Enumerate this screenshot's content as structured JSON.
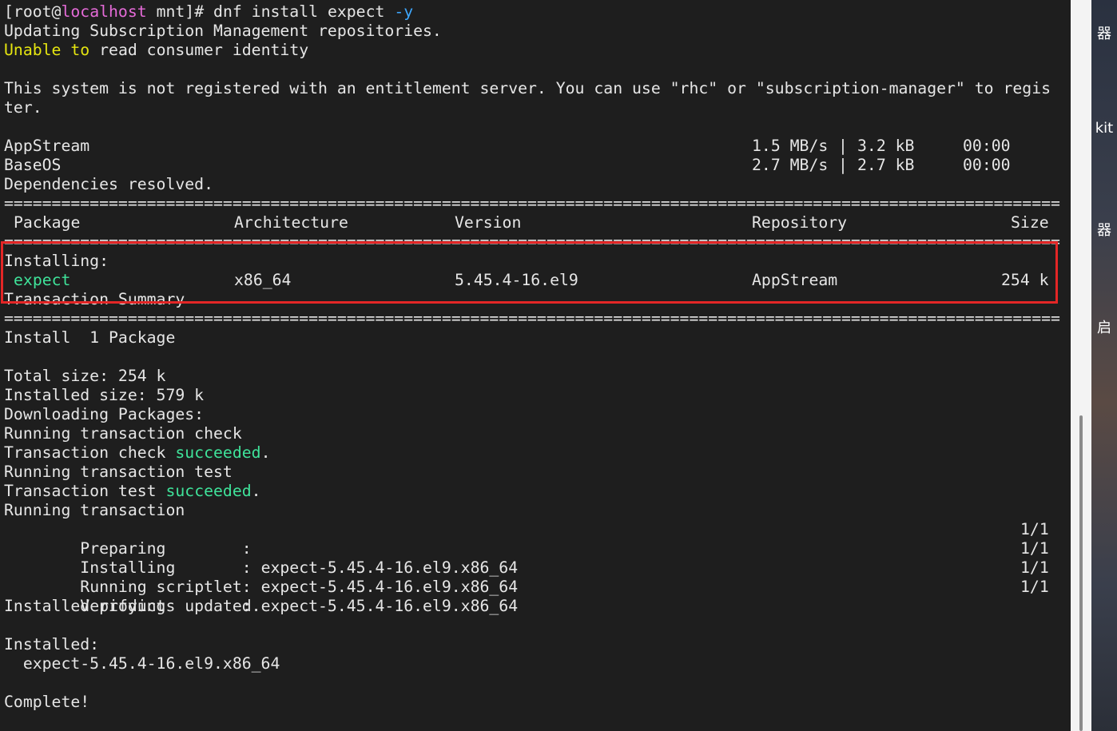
{
  "terminal": {
    "prompt": {
      "open": "[root@",
      "host": "localhost",
      "dir": " mnt]# ",
      "command": "dnf install expect ",
      "flag": "-y"
    },
    "line_updating": "Updating Subscription Management repositories.",
    "line_unable": {
      "w1": "Unable",
      "w2": "to",
      "rest": " read consumer identity"
    },
    "line_not_registered_1": "This system is not registered with an entitlement server. You can use \"rhc\" or \"subscription-manager\" to regis",
    "line_not_registered_2": "ter.",
    "repos": [
      {
        "name": "AppStream",
        "speed": "1.5 MB/s",
        "sep": "|",
        "size": "3.2 kB",
        "time": "00:00"
      },
      {
        "name": "BaseOS",
        "speed": "2.7 MB/s",
        "sep": "|",
        "size": "2.7 kB",
        "time": "00:00"
      }
    ],
    "line_deps": "Dependencies resolved.",
    "separator": "================================================================================================================================",
    "table_header": {
      "package": "Package",
      "arch": "Architecture",
      "version": "Version",
      "repo": "Repository",
      "size": "Size"
    },
    "installing_label": "Installing:",
    "package_row": {
      "package": "expect",
      "arch": "x86_64",
      "version": "5.45.4-16.el9",
      "repo": "AppStream",
      "size": "254 k"
    },
    "transaction_summary": "Transaction Summary",
    "install_count": "Install  1 Package",
    "total_size": "Total size: 254 k",
    "installed_size": "Installed size: 579 k",
    "downloading": "Downloading Packages:",
    "running_check": "Running transaction check",
    "check_succeeded": {
      "prefix": "Transaction check ",
      "word": "succeeded",
      "suffix": "."
    },
    "running_test": "Running transaction test",
    "test_succeeded": {
      "prefix": "Transaction test ",
      "word": "succeeded",
      "suffix": "."
    },
    "running_transaction": "Running transaction",
    "steps": [
      {
        "label": "  Preparing        :",
        "pkg": "",
        "progress": "1/1"
      },
      {
        "label": "  Installing       :",
        "pkg": " expect-5.45.4-16.el9.x86_64",
        "progress": "1/1"
      },
      {
        "label": "  Running scriptlet:",
        "pkg": " expect-5.45.4-16.el9.x86_64",
        "progress": "1/1"
      },
      {
        "label": "  Verifying        :",
        "pkg": " expect-5.45.4-16.el9.x86_64",
        "progress": "1/1"
      }
    ],
    "products_updated": "Installed products updated.",
    "installed_label": "Installed:",
    "installed_pkg": "  expect-5.45.4-16.el9.x86_64",
    "complete": "Complete!"
  },
  "desktop_labels": [
    "器",
    "kit",
    "器",
    "启"
  ],
  "colors": {
    "background": "#1e1e1e",
    "text": "#e6e6e6",
    "host": "#e56bd8",
    "flag": "#3ea8ff",
    "warning": "#e5e510",
    "success": "#3fe39a",
    "highlight_border": "#e32626"
  }
}
